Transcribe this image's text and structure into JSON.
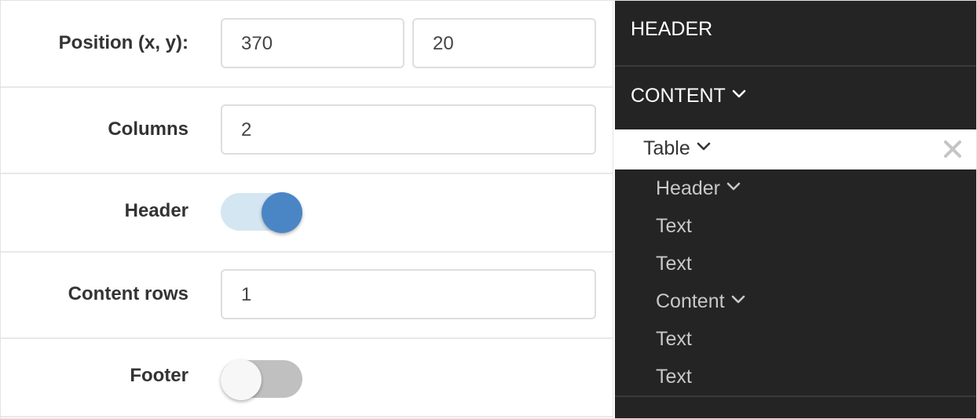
{
  "form": {
    "position": {
      "label": "Position (x, y):",
      "x_value": "370",
      "y_value": "20"
    },
    "columns": {
      "label": "Columns",
      "value": "2"
    },
    "header": {
      "label": "Header",
      "enabled": true,
      "track_color": "#d4e6f1",
      "knob_color": "#4a86c5"
    },
    "content_rows": {
      "label": "Content rows",
      "value": "1"
    },
    "footer": {
      "label": "Footer",
      "enabled": false,
      "track_color": "#c0c0c0",
      "knob_color": "#f7f7f7"
    }
  },
  "tree": {
    "header_section": "HEADER",
    "content_section": "CONTENT",
    "selected_item": "Table",
    "close_icon": "close-icon",
    "items": [
      {
        "label": "Header",
        "expandable": true
      },
      {
        "label": "Text",
        "expandable": false
      },
      {
        "label": "Text",
        "expandable": false
      },
      {
        "label": "Content",
        "expandable": true
      },
      {
        "label": "Text",
        "expandable": false
      },
      {
        "label": "Text",
        "expandable": false
      }
    ],
    "colors": {
      "background": "#242424",
      "selected_background": "#ffffff",
      "item_text": "#c8c8c8"
    }
  }
}
